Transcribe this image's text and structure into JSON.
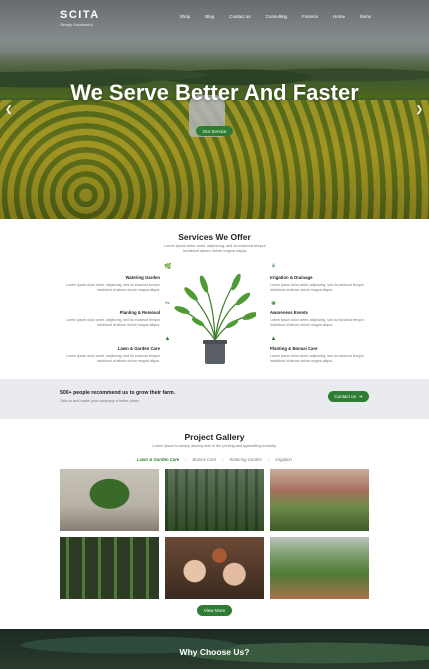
{
  "brand": {
    "name": "SCITA",
    "tagline": "Simply Successful"
  },
  "nav": [
    "Shop",
    "Blog",
    "Contact us",
    "Consulting",
    "Finance",
    "Home",
    "Items"
  ],
  "hero": {
    "title": "We Serve Better And Faster",
    "button": "Our Service"
  },
  "services": {
    "title": "Services We Offer",
    "subtitle": "Lorem ipsum dolor amet, adipiscing, sed do eiusmod tempor incididunt labore dolore magna aliqua.",
    "items": [
      {
        "title": "Watering Garden",
        "desc": "Lorem ipsum dolor amet, adipiscing, sed do eiusmod tempor incididunt ut labore dolore magna aliqua.",
        "icon": "leaf-icon"
      },
      {
        "title": "Planting & Removal",
        "desc": "Lorem ipsum dolor amet, adipiscing, sed do eiusmod tempor incididunt ut labore dolore magna aliqua.",
        "icon": "scissors-icon"
      },
      {
        "title": "Lawn & Garden Care",
        "desc": "Lorem ipsum dolor amet, adipiscing, sed do eiusmod tempor incididunt ut labore dolore magna aliqua.",
        "icon": "tree-icon"
      },
      {
        "title": "Irrigation & Drainage",
        "desc": "Lorem ipsum dolor amet, adipiscing, sed do eiusmod tempor incididunt ut labore dolore magna aliqua.",
        "icon": "plant-icon"
      },
      {
        "title": "Awareness Events",
        "desc": "Lorem ipsum dolor amet, adipiscing, sed do eiusmod tempor incididunt ut labore dolore magna aliqua.",
        "icon": "leaves-icon"
      },
      {
        "title": "Planting & Bonsai Care",
        "desc": "Lorem ipsum dolor amet, adipiscing, sed do eiusmod tempor incididunt ut labore dolore magna aliqua.",
        "icon": "pine-tree-icon"
      }
    ]
  },
  "cta": {
    "headline": "500+ people recommend us to grow their farm.",
    "subtext": "Join us and make your company a better place.",
    "button": "Contact us"
  },
  "gallery": {
    "title": "Project Gallery",
    "subtitle": "Lorem ipsum is simply dummy text of the printing and typesetting industry.",
    "filters": [
      "Lawn & Garden Care",
      "Bonsai Care",
      "Watering Garden",
      "Irrigation"
    ],
    "active_filter": 0,
    "button": "View More"
  },
  "why": {
    "title": "Why Choose Us?"
  },
  "colors": {
    "accent": "#2f7d32"
  }
}
